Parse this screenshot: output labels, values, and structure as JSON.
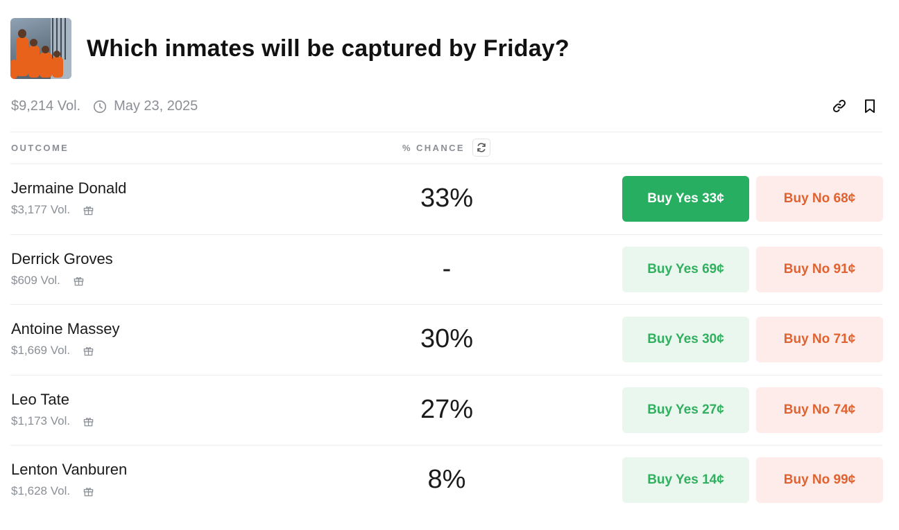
{
  "market": {
    "title": "Which inmates will be captured by Friday?",
    "volume": "$9,214 Vol.",
    "date": "May 23, 2025"
  },
  "table": {
    "outcome_header": "OUTCOME",
    "chance_header": "% CHANCE"
  },
  "outcomes": [
    {
      "name": "Jermaine Donald",
      "volume": "$3,177 Vol.",
      "chance": "33%",
      "buy_yes": "Buy Yes 33¢",
      "buy_no": "Buy No 68¢",
      "yes_selected": true
    },
    {
      "name": "Derrick Groves",
      "volume": "$609 Vol.",
      "chance": "-",
      "buy_yes": "Buy Yes 69¢",
      "buy_no": "Buy No 91¢",
      "yes_selected": false
    },
    {
      "name": "Antoine Massey",
      "volume": "$1,669 Vol.",
      "chance": "30%",
      "buy_yes": "Buy Yes 30¢",
      "buy_no": "Buy No 71¢",
      "yes_selected": false
    },
    {
      "name": "Leo Tate",
      "volume": "$1,173 Vol.",
      "chance": "27%",
      "buy_yes": "Buy Yes 27¢",
      "buy_no": "Buy No 74¢",
      "yes_selected": false
    },
    {
      "name": "Lenton Vanburen",
      "volume": "$1,628 Vol.",
      "chance": "8%",
      "buy_yes": "Buy Yes 14¢",
      "buy_no": "Buy No 99¢",
      "yes_selected": false
    }
  ],
  "icons": {
    "clock": "clock-icon",
    "link": "link-icon",
    "bookmark": "bookmark-icon",
    "refresh": "refresh-icon",
    "gift": "gift-icon"
  },
  "colors": {
    "yes_active_bg": "#27ae60",
    "yes_bg": "#e9f7ee",
    "yes_text": "#30b05e",
    "no_bg": "#fdecea",
    "no_text": "#e2622f"
  }
}
